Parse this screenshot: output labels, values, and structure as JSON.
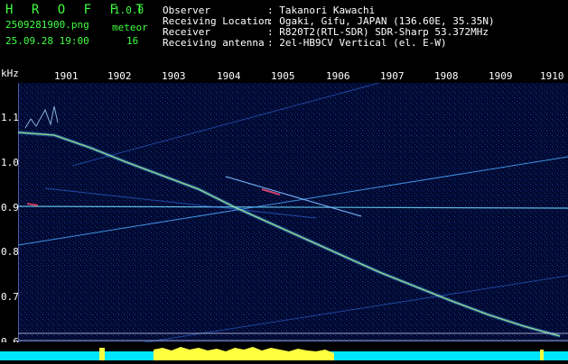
{
  "app": {
    "name": "H R O F F T",
    "version": "1.0.0"
  },
  "file": {
    "name": "2509281900.png",
    "datetime": "25.09.28 19:00"
  },
  "meteor": {
    "label": "meteor",
    "count": "16"
  },
  "info": [
    {
      "key": "Observer",
      "value": ": Takanori Kawachi"
    },
    {
      "key": "Receiving Location",
      "value": ": Ogaki, Gifu, JAPAN (136.60E, 35.35N)"
    },
    {
      "key": "Receiver",
      "value": ": R820T2(RTL-SDR) SDR-Sharp 53.372MHz"
    },
    {
      "key": "Receiving antenna",
      "value": ": 2el-HB9CV Vertical (el. E-W)"
    }
  ],
  "axis": {
    "y_unit": "kHz",
    "y_ticks": [
      "1.1",
      "1.0",
      "0.9",
      "0.8",
      "0.7",
      "0.6"
    ],
    "x_ticks": [
      "1901",
      "1902",
      "1903",
      "1904",
      "1905",
      "1906",
      "1907",
      "1908",
      "1909",
      "1910"
    ]
  },
  "colors": {
    "plot_bg": "#000a3a",
    "trace": "#5fd0ff",
    "meteor": "#c8ff60",
    "label_green": "#40ff40",
    "label_yellow": "#ffff40",
    "floor_cyan": "#00e5ff"
  }
}
